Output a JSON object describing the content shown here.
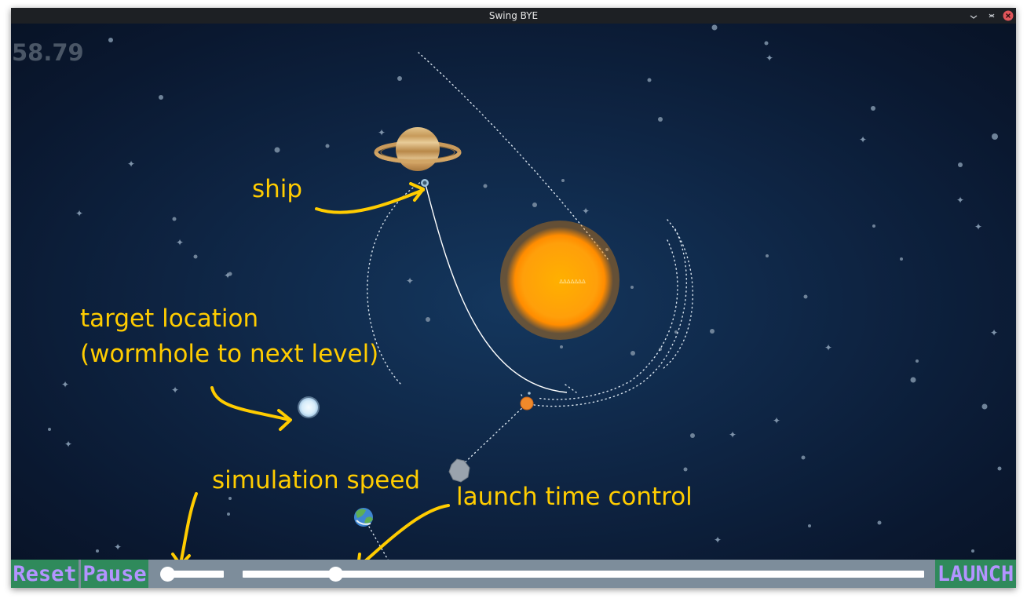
{
  "window": {
    "title": "Swing BYE"
  },
  "hud": {
    "fps": "58.79"
  },
  "annotations": {
    "ship": "ship",
    "target_line1": "target location",
    "target_line2": "(wormhole to next level)",
    "speed": "simulation speed",
    "launch_time": "launch time control"
  },
  "sun": {
    "label": "ΔΔΔΔΔΔΔ"
  },
  "controls": {
    "reset_label": "Reset",
    "pause_label": "Pause",
    "launch_label": "LAUNCH",
    "simulation_speed_value": 0.0,
    "launch_time_value": 0.13
  },
  "colors": {
    "annotation": "#ffcc00",
    "button_bg": "#2f8a5b",
    "button_text": "#b394ff",
    "control_bar": "#7d8d9b",
    "space_center": "#14375e"
  }
}
